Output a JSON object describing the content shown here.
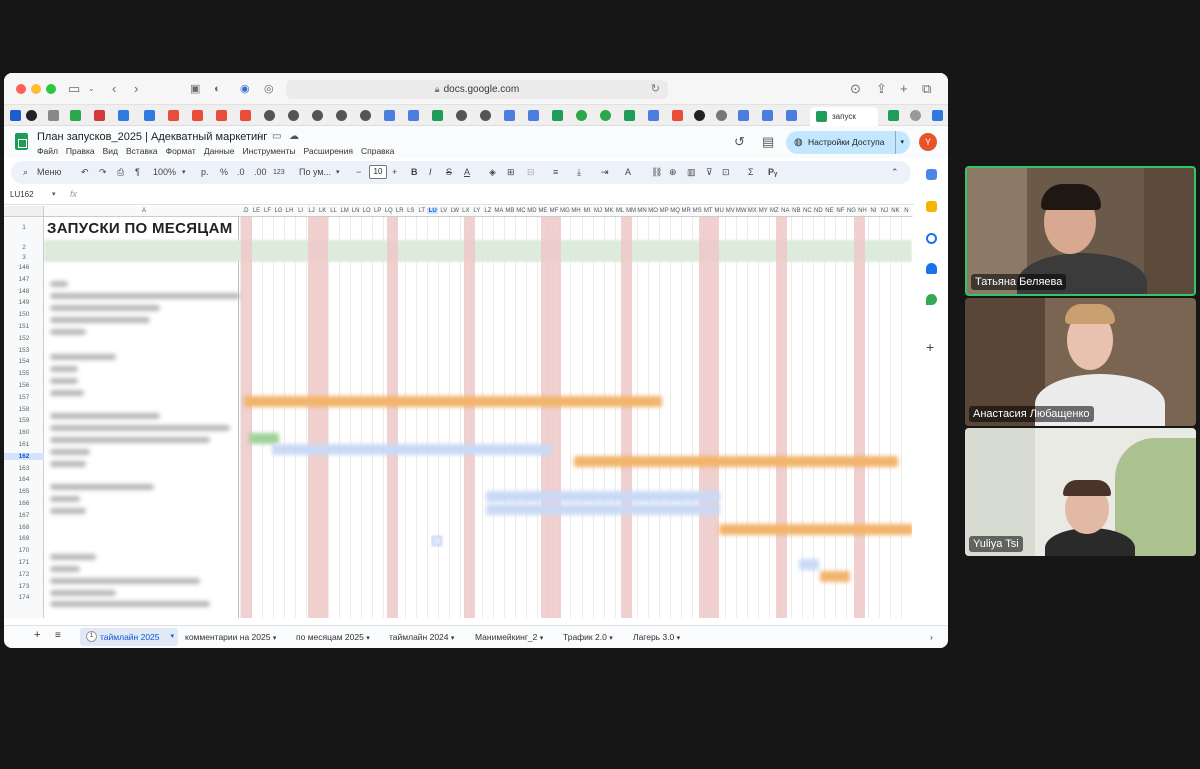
{
  "browser": {
    "url": "docs.google.com",
    "active_tab_label": "запуск"
  },
  "sheet": {
    "title": "План запусков_2025 | Адекватный маркетинг",
    "menus": [
      "Файл",
      "Правка",
      "Вид",
      "Вставка",
      "Формат",
      "Данные",
      "Инструменты",
      "Расширения",
      "Справка"
    ],
    "share_label": "Настройки Доступа",
    "avatar_letter": "Y",
    "toolbar": {
      "menu_search": "Меню",
      "zoom": "100%",
      "currency": "р.",
      "percent": "%",
      "decimal_dec": ".0",
      "decimal_inc": ".00",
      "number_format": "123",
      "font": "По ум...",
      "font_size": "10"
    },
    "namebox": "LU162",
    "fx": "fx",
    "column_a_header": "A",
    "column_headers": [
      ".D",
      "LE",
      "LF",
      "LG",
      "LH",
      "LI",
      "LJ",
      "LK",
      "LL",
      "LM",
      "LN",
      "LO",
      "LP",
      "LQ",
      "LR",
      "LS",
      "LT",
      "LU",
      "LV",
      "LW",
      "LX",
      "LY",
      "LZ",
      "MA",
      "MB",
      "MC",
      "MD",
      "ME",
      "MF",
      "MG",
      "MH",
      "MI",
      "MJ",
      "MK",
      "ML",
      "MM",
      "MN",
      "MO",
      "MP",
      "MQ",
      "MR",
      "MS",
      "MT",
      "MU",
      "MV",
      "MW",
      "MX",
      "MY",
      "MZ",
      "NA",
      "NB",
      "NC",
      "ND",
      "NE",
      "NF",
      "NG",
      "NH",
      "NI",
      "NJ",
      "NK",
      "N"
    ],
    "selected_column": "LU",
    "title_cell": "ЗАПУСКИ ПО МЕСЯЦАМ",
    "row_numbers": [
      "1",
      "2",
      "3",
      "146",
      "147",
      "148",
      "149",
      "150",
      "151",
      "152",
      "153",
      "154",
      "155",
      "156",
      "157",
      "158",
      "159",
      "160",
      "161",
      "162",
      "163",
      "164",
      "165",
      "166",
      "167",
      "168",
      "169",
      "170",
      "171",
      "172",
      "173",
      "174"
    ],
    "selected_row": "162",
    "tabs": {
      "active_num": "1",
      "active_label": "таймлайн 2025",
      "others": [
        "комментарии на 2025",
        "по месяцам 2025",
        "таймлайн 2024",
        "Манимейкинг_2",
        "Трафик 2.0",
        "Лагерь 3.0"
      ]
    }
  },
  "participants": [
    {
      "name": "Татьяна Беляева",
      "speaking": true
    },
    {
      "name": "Анастасия Любащенко",
      "speaking": false
    },
    {
      "name": "Yuliya Tsi",
      "speaking": false
    }
  ],
  "colors": {
    "accent": "#0b57d0",
    "share_bg": "#c2e7ff",
    "speaking_border": "#36c46a",
    "stripe_pink": "#efc8c8",
    "bar_orange": "#f2b46b",
    "bar_blue": "#c9d9f5",
    "bar_green": "#9fd29a"
  }
}
